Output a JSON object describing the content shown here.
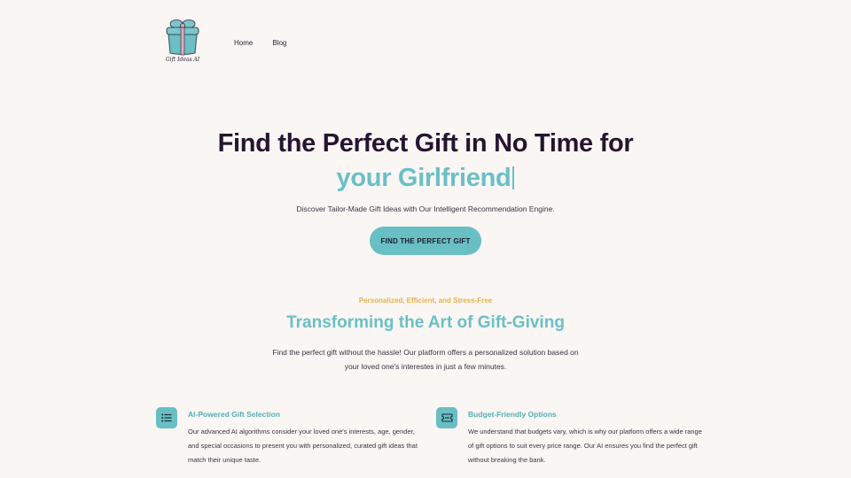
{
  "header": {
    "logo_text": "Gift Ideas AI",
    "nav": [
      {
        "label": "Home"
      },
      {
        "label": "Blog"
      }
    ]
  },
  "hero": {
    "title": "Find the Perfect Gift in No Time for",
    "subtitle": "your Girlfriend",
    "description": "Discover Tailor-Made Gift Ideas with Our Intelligent Recommendation Engine.",
    "cta_label": "FIND THE PERFECT GIFT"
  },
  "section": {
    "eyebrow": "Personalized, Efficient, and Stress-Free",
    "title": "Transforming the Art of Gift-Giving",
    "description": "Find the perfect gift without the hassle! Our platform offers a personalized solution based on your loved one's interestes in just a few minutes."
  },
  "features": [
    {
      "icon": "list-icon",
      "title": "AI-Powered Gift Selection",
      "body": "Our advanced AI algorithms consider your loved one's interests, age, gender, and special occasions to present you with personalized, curated gift ideas that match their unique taste."
    },
    {
      "icon": "ticket-icon",
      "title": "Budget-Friendly Options",
      "body": "We understand that budgets vary, which is why our platform offers a wide range of gift options to suit every price range. Our AI ensures you find the perfect gift without breaking the bank."
    }
  ],
  "colors": {
    "accent": "#68bfc4",
    "heading": "#241530",
    "eyebrow": "#e7b04b",
    "background": "#f9f6f3"
  }
}
